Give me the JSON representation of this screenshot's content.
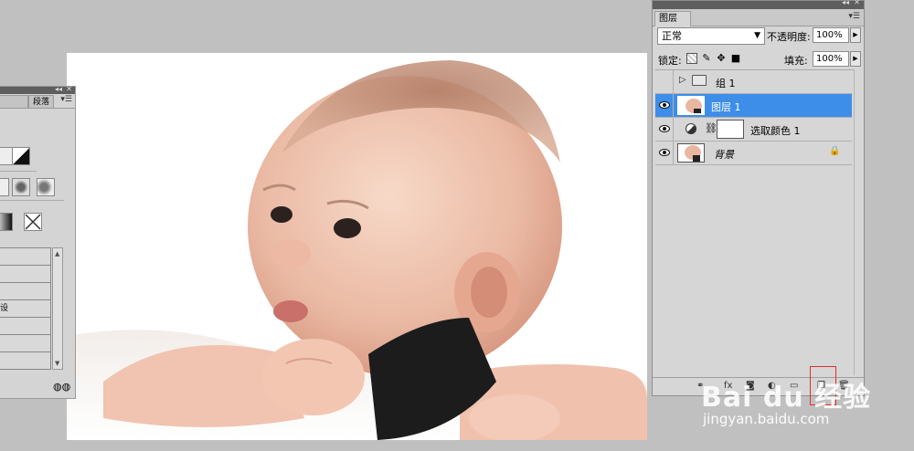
{
  "layers_panel": {
    "tab_label": "图层",
    "blend_mode": "正常",
    "opacity_label": "不透明度:",
    "opacity_value": "100%",
    "lock_label": "锁定:",
    "fill_label": "填充:",
    "fill_value": "100%",
    "layers": [
      {
        "name": "组 1",
        "type": "group",
        "visible": false,
        "selected": false
      },
      {
        "name": "图层 1",
        "type": "pixel",
        "visible": true,
        "selected": true
      },
      {
        "name": "选取颜色 1",
        "type": "adjustment",
        "visible": true,
        "selected": false
      },
      {
        "name": "背景",
        "type": "background",
        "visible": true,
        "selected": false,
        "locked": true
      }
    ]
  },
  "left_panel": {
    "tab_2_label": "段落",
    "list_row_text": "设"
  },
  "watermark": {
    "logo_text": "Bai du 经验",
    "url_text": "jingyan.baidu.com"
  },
  "colors": {
    "selection_blue": "#3d8ee8",
    "app_background": "#c0c0c0",
    "panel_background": "#d6d6d6"
  }
}
